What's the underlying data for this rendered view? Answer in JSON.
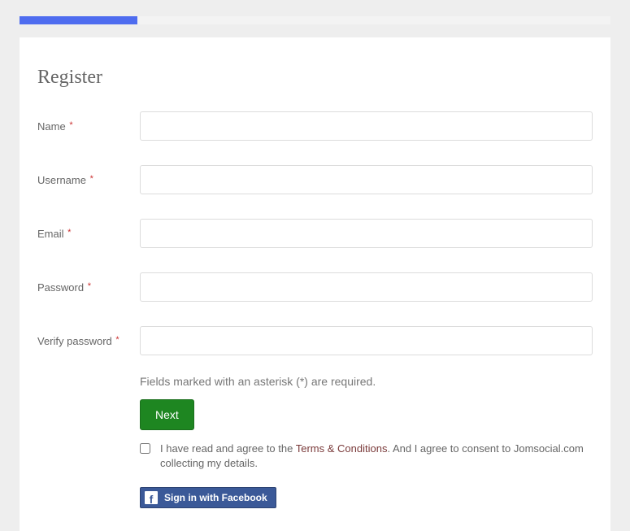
{
  "progress": {
    "percent": 20
  },
  "title": "Register",
  "required_marker": "*",
  "fields": {
    "name": {
      "label": "Name",
      "value": "",
      "required": true
    },
    "username": {
      "label": "Username",
      "value": "",
      "required": true
    },
    "email": {
      "label": "Email",
      "value": "",
      "required": true
    },
    "password": {
      "label": "Password",
      "value": "",
      "required": true
    },
    "verify_password": {
      "label": "Verify password",
      "value": "",
      "required": true
    }
  },
  "hint": "Fields marked with an asterisk (*) are required.",
  "next_label": "Next",
  "consent": {
    "checked": false,
    "pre_text": "I have read and agree to the ",
    "terms_label": "Terms & Conditions",
    "post_text": ". And I agree to consent to Jomsocial.com collecting my details."
  },
  "facebook_label": "Sign in with Facebook"
}
